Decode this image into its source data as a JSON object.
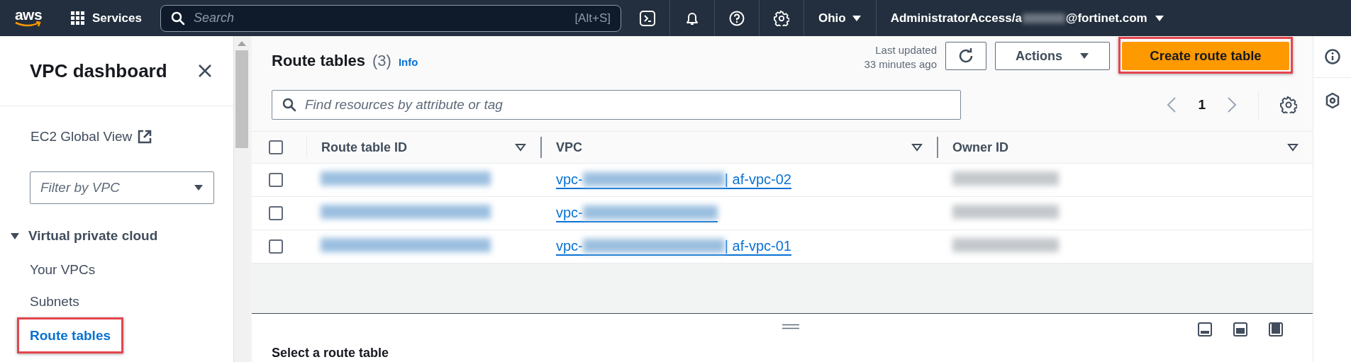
{
  "top_nav": {
    "logo": "aws",
    "services": "Services",
    "search_placeholder": "Search",
    "search_shortcut": "[Alt+S]",
    "region": "Ohio",
    "account_prefix": "AdministratorAccess/a",
    "account_suffix": "@fortinet.com"
  },
  "sidebar": {
    "title": "VPC dashboard",
    "global_view": "EC2 Global View",
    "filter_placeholder": "Filter by VPC",
    "section": {
      "label": "Virtual private cloud",
      "expanded": true,
      "items": [
        {
          "label": "Your VPCs",
          "selected": false,
          "highlighted": false
        },
        {
          "label": "Subnets",
          "selected": false,
          "highlighted": false
        },
        {
          "label": "Route tables",
          "selected": true,
          "highlighted": true
        }
      ]
    }
  },
  "main": {
    "title": "Route tables",
    "count": "(3)",
    "info": "Info",
    "last_updated_label": "Last updated",
    "last_updated_time": "33 minutes ago",
    "actions": "Actions",
    "create": {
      "label": "Create route table",
      "highlighted": true
    },
    "search_placeholder": "Find resources by attribute or tag",
    "page": "1",
    "all_selected": false,
    "columns": [
      "Route table ID",
      "VPC",
      "Owner ID"
    ],
    "rows": [
      {
        "selected": false,
        "vpc_prefix": "vpc-",
        "vpc_name": "| af-vpc-02"
      },
      {
        "selected": false,
        "vpc_prefix": "vpc-"
      },
      {
        "selected": false,
        "vpc_prefix": "vpc-",
        "vpc_name": "| af-vpc-01"
      }
    ]
  },
  "split_panel": {
    "title": "Select a route table"
  }
}
